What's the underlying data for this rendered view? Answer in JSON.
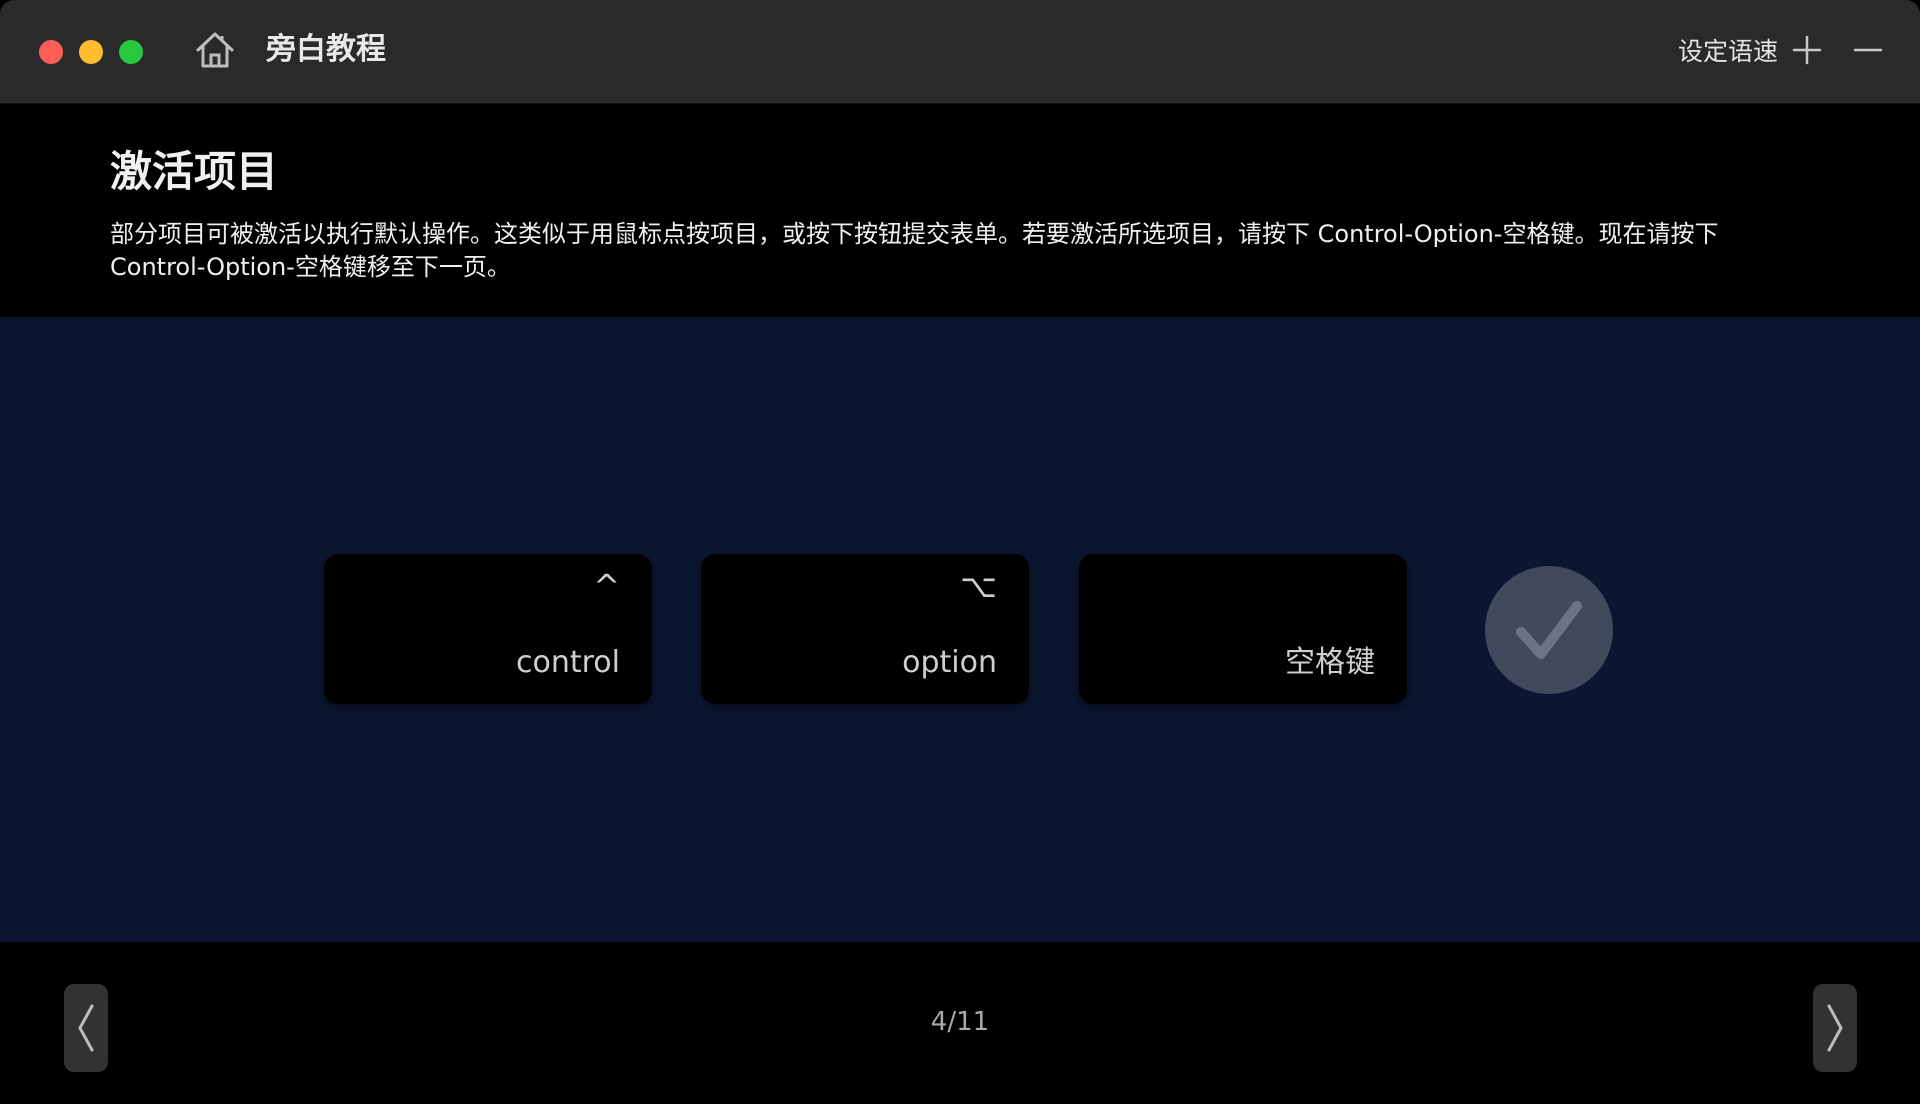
{
  "titlebar": {
    "app_title": "旁白教程",
    "speed_label": "设定语速",
    "icons": [
      "home-icon",
      "plus-icon",
      "minus-icon"
    ]
  },
  "header": {
    "title": "激活项目",
    "description": "部分项目可被激活以执行默认操作。这类似于用鼠标点按项目，或按下按钮提交表单。若要激活所选项目，请按下 Control-Option-空格键。现在请按下 Control-Option-空格键移至下一页。"
  },
  "keys": [
    {
      "symbol": "^",
      "label": "control"
    },
    {
      "symbol": "⌥",
      "label": "option"
    },
    {
      "symbol": "",
      "label": "空格键"
    }
  ],
  "footer": {
    "page_indicator": "4/11"
  },
  "colors": {
    "titlebar_bg": "#2a2a2c",
    "stage_bg": "#0b1730",
    "key_bg": "#000000",
    "check_bg": "#414a5c",
    "traffic_close": "#ff5f57",
    "traffic_minimize": "#febc2e",
    "traffic_zoom": "#28c840"
  }
}
